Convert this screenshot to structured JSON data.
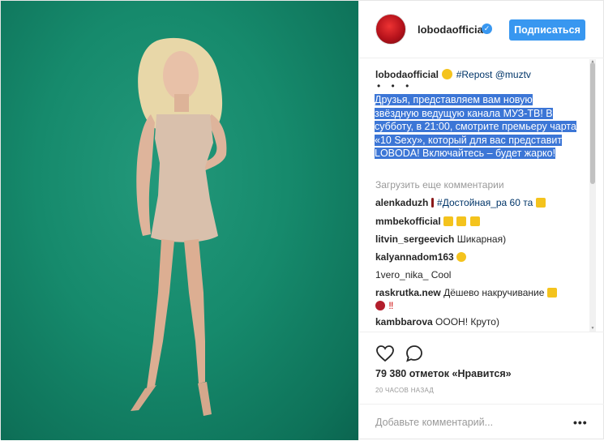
{
  "header": {
    "username": "lobodaofficial",
    "verified_mark": "✓",
    "follow_label": "Подписаться"
  },
  "caption": {
    "author": "lobodaofficial",
    "tag": "#Repost @muztv",
    "dots": "• • •",
    "text": "Друзья, представляем вам новую звёздную ведущую канала МУЗ-ТВ! В субботу, в 21:00, смотрите премьеру чарта «10 Sexy», который для вас представит LOBODA! Включайтесь – будет жарко!"
  },
  "load_more": "Загрузить еще комментарии",
  "comments": [
    {
      "user": "alenkaduzh",
      "text": "#Достойная_ра 60 та"
    },
    {
      "user": "mmbekofficial",
      "text": ""
    },
    {
      "user": "litvin_sergeevich",
      "text": "Шикарная)"
    },
    {
      "user": "kalyannadom163",
      "text": ""
    },
    {
      "user": "1vero_nika_",
      "text": "Cool"
    },
    {
      "user": "raskrutka.new",
      "text": "Дёшево накручивание",
      "text2": "‼"
    },
    {
      "user": "kambbarova",
      "text": "ОООН! Круто)"
    }
  ],
  "likes": "79 380 отметок «Нравится»",
  "time_ago": "20 ЧАСОВ НАЗАД",
  "add_comment_placeholder": "Добавьте комментарий...",
  "more_options": "•••",
  "icons": {
    "like": "heart-icon",
    "comment": "comment-bubble-icon",
    "verified": "verified-badge-icon"
  },
  "colors": {
    "accent": "#3897f0",
    "selection": "#3c76d6",
    "photo_bg": "#168a6c"
  }
}
